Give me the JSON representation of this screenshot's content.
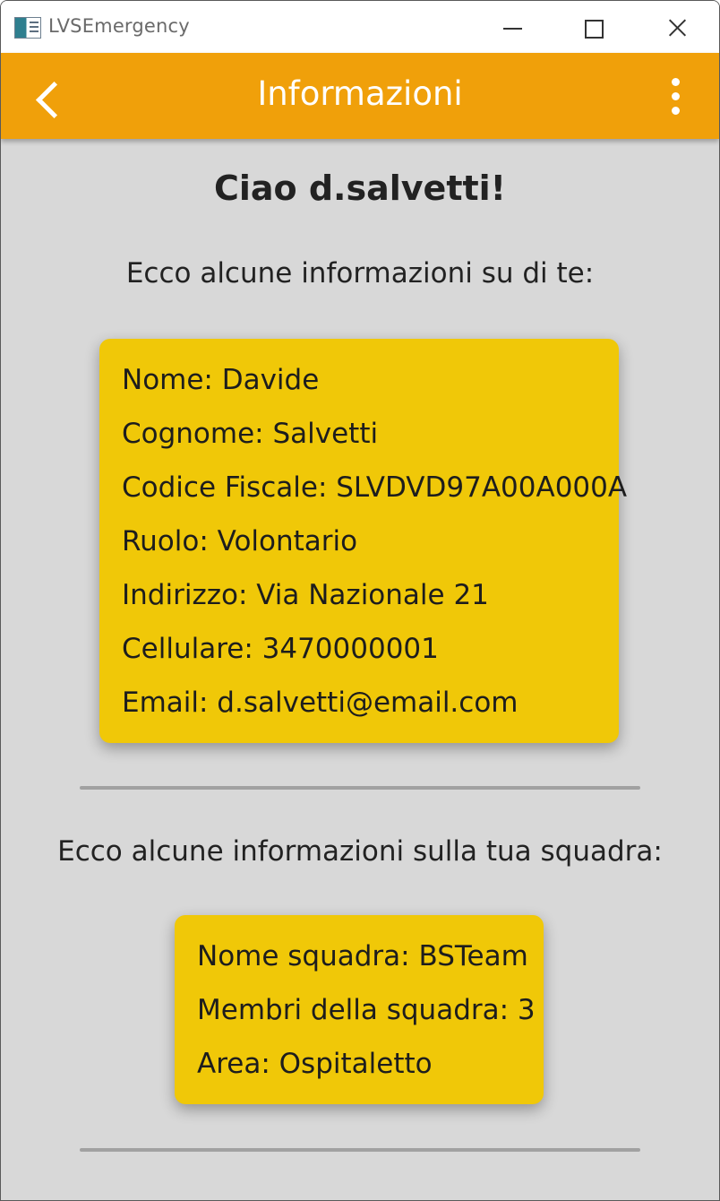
{
  "window": {
    "title": "LVSEmergency",
    "controls": {
      "minimize_icon": "minimize-icon",
      "maximize_icon": "maximize-icon",
      "close_icon": "close-icon"
    }
  },
  "appbar": {
    "title": "Informazioni",
    "back_icon": "chevron-left-icon",
    "more_icon": "more-vertical-icon",
    "background_color": "#f0a00a"
  },
  "main": {
    "greeting": "Ciao d.salvetti!",
    "user_intro": "Ecco alcune informazioni su di te:",
    "user_info": [
      "Nome: Davide",
      "Cognome: Salvetti",
      "Codice Fiscale: SLVDVD97A00A000A",
      "Ruolo: Volontario",
      "Indirizzo: Via Nazionale 21",
      "Cellulare: 3470000001",
      "Email: d.salvetti@email.com"
    ],
    "team_intro": "Ecco alcune informazioni sulla tua squadra:",
    "team_info": [
      "Nome squadra: BSTeam",
      "Membri della squadra: 3",
      "Area: Ospitaletto"
    ]
  },
  "colors": {
    "card_background": "#f0c808",
    "page_background": "#d8d8d8",
    "divider": "#a1a1a1"
  }
}
